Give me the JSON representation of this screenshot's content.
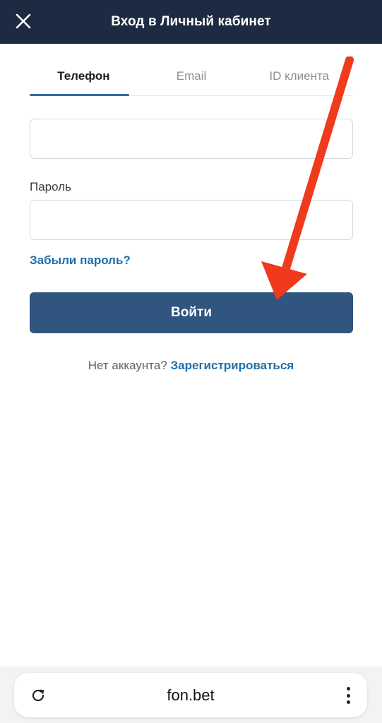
{
  "header": {
    "title": "Вход в Личный кабинет",
    "close_icon": "close-icon"
  },
  "tabs": [
    {
      "label": "Телефон",
      "active": true
    },
    {
      "label": "Email",
      "active": false
    },
    {
      "label": "ID клиента",
      "active": false
    }
  ],
  "form": {
    "phone_value": "",
    "password_label": "Пароль",
    "password_value": "",
    "forgot_label": "Забыли пароль?",
    "login_label": "Войти",
    "no_account_text": "Нет аккаунта?",
    "register_label": "Зарегистрироваться"
  },
  "browser": {
    "url": "fon.bet",
    "reload_icon": "reload-icon",
    "more_icon": "more-vertical-icon"
  },
  "colors": {
    "header_bg": "#1d2b42",
    "primary_button": "#30557e",
    "link": "#1f6fa8",
    "annotation_arrow": "#f03a1e"
  }
}
